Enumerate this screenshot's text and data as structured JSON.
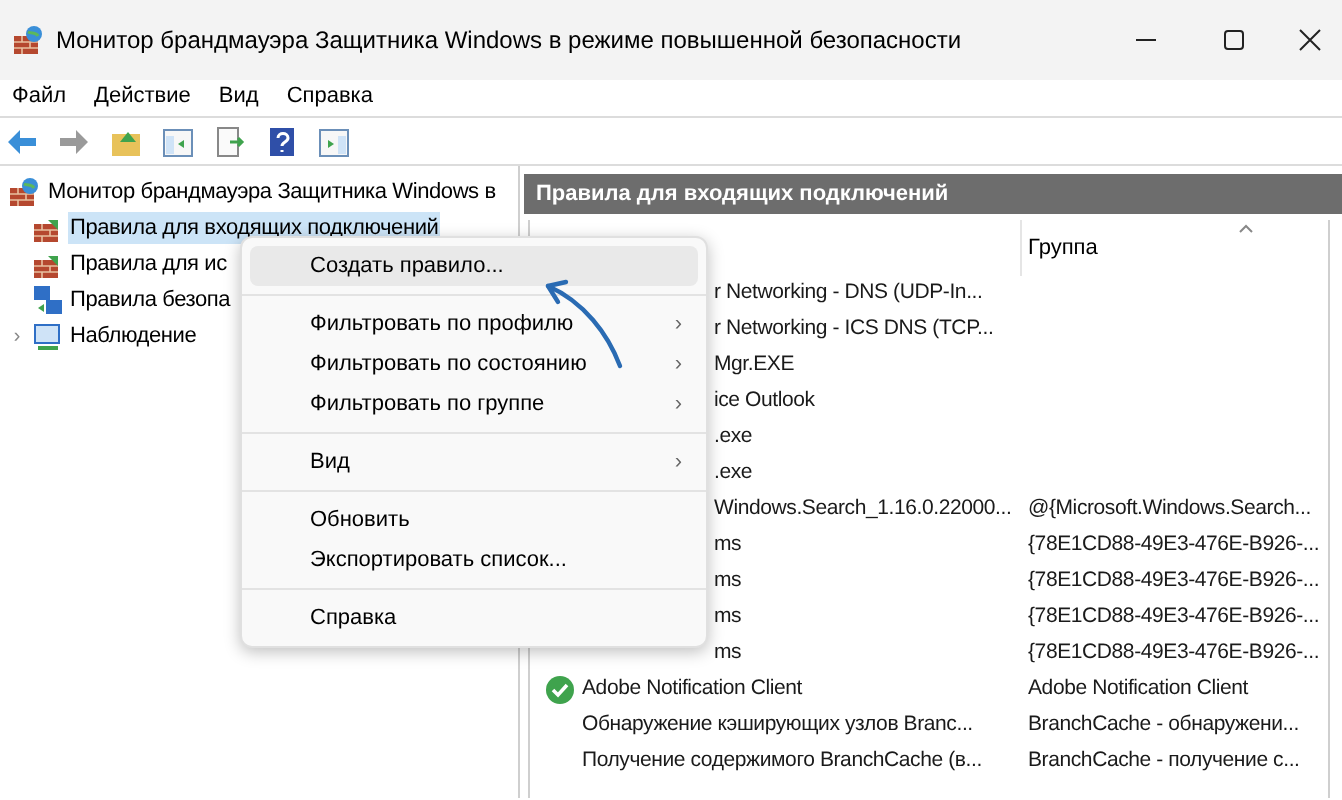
{
  "window": {
    "title": "Монитор брандмауэра Защитника Windows в режиме повышенной безопасности"
  },
  "menu_bar": [
    "Файл",
    "Действие",
    "Вид",
    "Справка"
  ],
  "tree": {
    "label": "Монитор брандмауэра Защитника Windows в",
    "children": [
      {
        "label": "Правила для входящих подключений",
        "selected": true,
        "kind": "inbound"
      },
      {
        "label": "Правила для ис",
        "selected": false,
        "kind": "outbound"
      },
      {
        "label": "Правила безопа",
        "selected": false,
        "kind": "security"
      },
      {
        "label": "Наблюдение",
        "selected": false,
        "kind": "monitor",
        "expanded": false
      }
    ]
  },
  "pane": {
    "title": "Правила для входящих подключений",
    "group_header": "Группа"
  },
  "rows": [
    {
      "name": "r Networking - DNS (UDP-In...",
      "group": "",
      "kind": "covered"
    },
    {
      "name": "r Networking - ICS DNS (TCP...",
      "group": "",
      "kind": "covered"
    },
    {
      "name": "Mgr.EXE",
      "group": "",
      "kind": "covered"
    },
    {
      "name": "ice Outlook",
      "group": "",
      "kind": "covered"
    },
    {
      "name": ".exe",
      "group": "",
      "kind": "covered"
    },
    {
      "name": ".exe",
      "group": "",
      "kind": "covered"
    },
    {
      "name": "Windows.Search_1.16.0.22000...",
      "group": "@{Microsoft.Windows.Search...",
      "kind": "covered"
    },
    {
      "name": "ms",
      "group": "{78E1CD88-49E3-476E-B926-...",
      "kind": "covered"
    },
    {
      "name": "ms",
      "group": "{78E1CD88-49E3-476E-B926-...",
      "kind": "covered"
    },
    {
      "name": "ms",
      "group": "{78E1CD88-49E3-476E-B926-...",
      "kind": "covered"
    },
    {
      "name": "ms",
      "group": "{78E1CD88-49E3-476E-B926-...",
      "kind": "covered"
    },
    {
      "name": "Adobe Notification Client",
      "group": "Adobe Notification Client",
      "kind": "enabled"
    },
    {
      "name": "Обнаружение кэширующих узлов Branc...",
      "group": "BranchCache - обнаружени...",
      "kind": "plain"
    },
    {
      "name": "Получение содержимого BranchCache (в...",
      "group": "BranchCache - получение с...",
      "kind": "plain"
    }
  ],
  "context_menu": [
    {
      "kind": "item",
      "label": "Создать правило...",
      "selected": true
    },
    {
      "kind": "separator"
    },
    {
      "kind": "submenu",
      "label": "Фильтровать по профилю",
      "arrow": "›",
      "selected": false
    },
    {
      "kind": "submenu",
      "label": "Фильтровать по состоянию",
      "arrow": "›",
      "selected": false
    },
    {
      "kind": "submenu",
      "label": "Фильтровать по группе",
      "arrow": "›",
      "selected": false
    },
    {
      "kind": "separator"
    },
    {
      "kind": "submenu",
      "label": "Вид",
      "arrow": "›",
      "selected": false
    },
    {
      "kind": "separator"
    },
    {
      "kind": "item",
      "label": "Обновить",
      "selected": false
    },
    {
      "kind": "item",
      "label": "Экспортировать список...",
      "selected": false
    },
    {
      "kind": "separator"
    },
    {
      "kind": "item",
      "label": "Справка",
      "selected": false
    }
  ],
  "tree_expander": "›"
}
